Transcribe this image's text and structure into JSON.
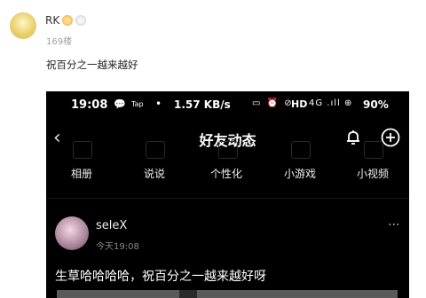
{
  "comment": {
    "username": "RK",
    "floor": "169楼",
    "text": "祝百分之一越来越好"
  },
  "phone": {
    "status_bar": {
      "time": "19:08",
      "wechat_icon": "💬",
      "tap_label": "Tap",
      "dot": "•",
      "speed": "1.57 KB/s",
      "hd": "HD",
      "network": "4G .ıll ⊕",
      "battery": "90%"
    },
    "navbar": {
      "back": "‹",
      "title": "好友动态"
    },
    "tabs": [
      "相册",
      "说说",
      "个性化",
      "小游戏",
      "小视频"
    ],
    "post": {
      "username": "seleX",
      "time": "今天19:08",
      "more": "···",
      "text": "生草哈哈哈哈，祝百分之一越来越好呀"
    }
  },
  "colors": {
    "phone_bg": "#000000",
    "page_bg": "#ffffff"
  }
}
